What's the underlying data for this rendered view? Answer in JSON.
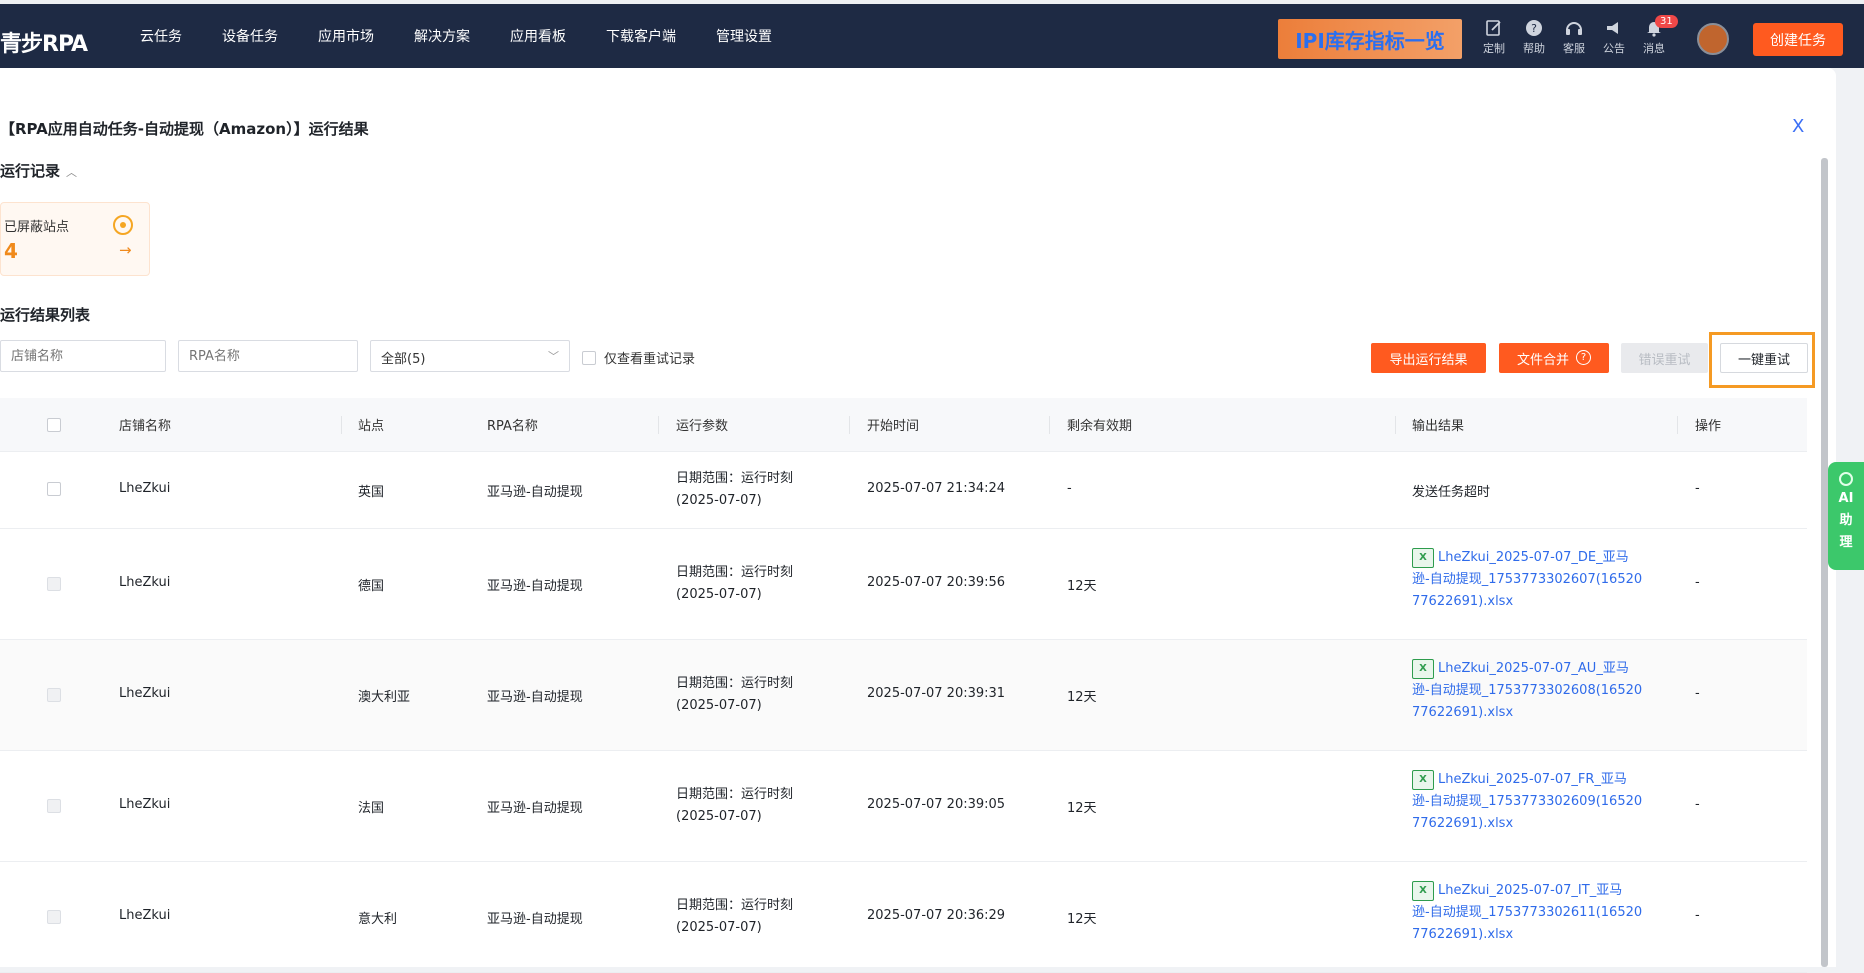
{
  "app": {
    "logo": "青步RPA",
    "nav": [
      "云任务",
      "设备任务",
      "应用市场",
      "解决方案",
      "应用看板",
      "下载客户端",
      "管理设置"
    ],
    "banner": "IPI库存指标一览",
    "tools": [
      {
        "icon": "customize-icon",
        "label": "定制"
      },
      {
        "icon": "help-icon",
        "label": "帮助"
      },
      {
        "icon": "support-icon",
        "label": "客服"
      },
      {
        "icon": "announcement-icon",
        "label": "公告"
      },
      {
        "icon": "bell-icon",
        "label": "消息",
        "badge": "31"
      }
    ],
    "create_button": "创建任务"
  },
  "page": {
    "title": "【RPA应用自动任务-自动提现（Amazon）】运行结果",
    "close": "X",
    "run_record": "运行记录",
    "stat": {
      "label": "已屏蔽站点",
      "value": "4"
    },
    "list_title": "运行结果列表"
  },
  "filters": {
    "store_placeholder": "店铺名称",
    "rpa_placeholder": "RPA名称",
    "status_select": "全部(5)",
    "retry_only_label": "仅查看重试记录"
  },
  "actions": {
    "export": "导出运行结果",
    "merge": "文件合并",
    "error_retry": "错误重试",
    "retry_all": "一键重试"
  },
  "table": {
    "headers": [
      "店铺名称",
      "站点",
      "RPA名称",
      "运行参数",
      "开始时间",
      "剩余有效期",
      "输出结果",
      "操作"
    ],
    "rows": [
      {
        "store": "LheZkui",
        "site": "英国",
        "rpa": "亚马逊-自动提现",
        "param1": "日期范围：运行时刻",
        "param2": "(2025-07-07)",
        "start": "2025-07-07 21:34:24",
        "remain": "-",
        "result": "发送任务超时",
        "op": "-"
      },
      {
        "store": "LheZkui",
        "site": "德国",
        "rpa": "亚马逊-自动提现",
        "param1": "日期范围：运行时刻",
        "param2": "(2025-07-07)",
        "start": "2025-07-07 20:39:56",
        "remain": "12天",
        "file_l1": "LheZkui_2025-07-07_DE_亚马",
        "file_l2": "逊-自动提现_1753773302607(16520",
        "file_l3": "77622691).xlsx",
        "op": "-"
      },
      {
        "store": "LheZkui",
        "site": "澳大利亚",
        "rpa": "亚马逊-自动提现",
        "param1": "日期范围：运行时刻",
        "param2": "(2025-07-07)",
        "start": "2025-07-07 20:39:31",
        "remain": "12天",
        "file_l1": "LheZkui_2025-07-07_AU_亚马",
        "file_l2": "逊-自动提现_1753773302608(16520",
        "file_l3": "77622691).xlsx",
        "op": "-"
      },
      {
        "store": "LheZkui",
        "site": "法国",
        "rpa": "亚马逊-自动提现",
        "param1": "日期范围：运行时刻",
        "param2": "(2025-07-07)",
        "start": "2025-07-07 20:39:05",
        "remain": "12天",
        "file_l1": "LheZkui_2025-07-07_FR_亚马",
        "file_l2": "逊-自动提现_1753773302609(16520",
        "file_l3": "77622691).xlsx",
        "op": "-"
      },
      {
        "store": "LheZkui",
        "site": "意大利",
        "rpa": "亚马逊-自动提现",
        "param1": "日期范围：运行时刻",
        "param2": "(2025-07-07)",
        "start": "2025-07-07 20:36:29",
        "remain": "12天",
        "file_l1": "LheZkui_2025-07-07_IT_亚马",
        "file_l2": "逊-自动提现_1753773302611(16520",
        "file_l3": "77622691).xlsx",
        "op": "-"
      }
    ]
  },
  "assistant": {
    "label": "AI助理"
  },
  "colors": {
    "accent": "#ff5a1f",
    "nav_bg": "#1e2a44",
    "link": "#2f6bea",
    "highlight": "#f59a23",
    "assistant": "#3cc86b"
  }
}
